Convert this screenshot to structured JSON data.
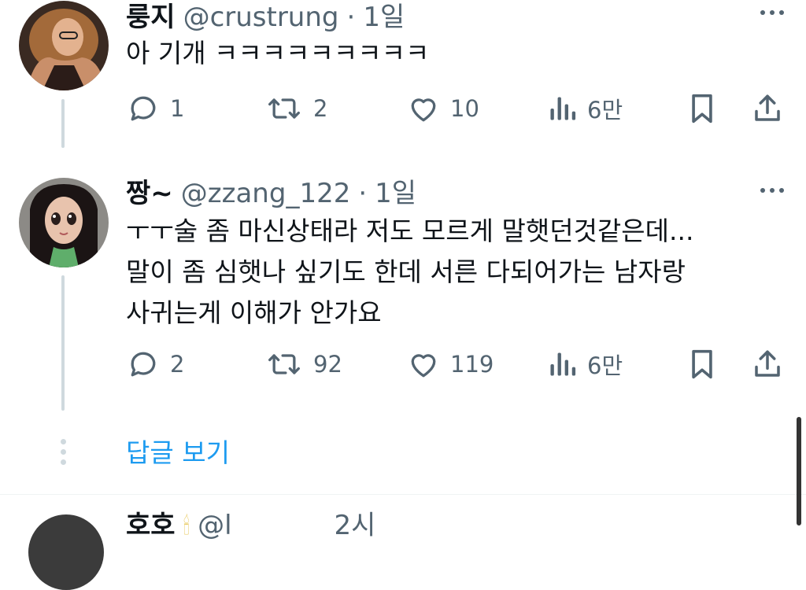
{
  "tweets": [
    {
      "name": "룽지",
      "handle": "@crustrung",
      "sep": "·",
      "time": "1일",
      "lines": [
        "아 기개 ㅋㅋㅋㅋㅋㅋㅋㅋㅋ"
      ],
      "replies": "1",
      "retweets": "2",
      "likes": "10",
      "views": "6만"
    },
    {
      "name": "짱~",
      "handle": "@zzang_122",
      "sep": "·",
      "time": "1일",
      "lines": [
        "ㅜㅜ술 좀 마신상태라 저도 모르게 말햇던것같은데...",
        "말이 좀 심햇나 싶기도 한데 서른 다되어가는 남자랑",
        "사귀는게 이해가 안가요"
      ],
      "replies": "2",
      "retweets": "92",
      "likes": "119",
      "views": "6만"
    }
  ],
  "show_replies": "답글 보기",
  "next_tweet": {
    "name": "호호",
    "handle": "@l",
    "time": "2시"
  },
  "colors": {
    "text": "#0f1419",
    "secondary": "#536471",
    "link": "#1d9bf0",
    "thread_line": "#cfd9de"
  }
}
